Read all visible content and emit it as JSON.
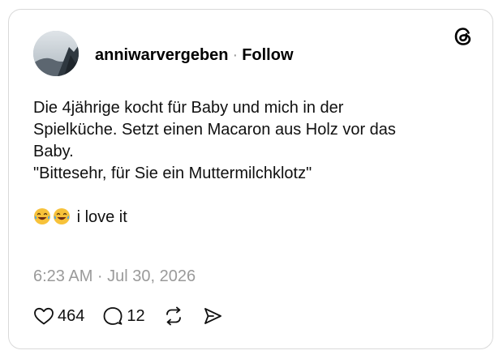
{
  "post": {
    "username": "anniwarvergeben",
    "separator": "·",
    "follow_label": "Follow",
    "text_lines": [
      "Die 4jährige kocht für Baby und mich in der",
      "Spielküche. Setzt einen Macaron aus Holz vor das",
      "Baby.",
      "\"Bittesehr, für Sie ein Muttermilchklotz\""
    ],
    "emoji_line_text": "i love it",
    "emojis": [
      "face-with-tears-of-joy",
      "face-with-tears-of-joy"
    ],
    "timestamp": "6:23 AM · Jul 30, 2026"
  },
  "actions": {
    "like_count": "464",
    "reply_count": "12"
  },
  "icons": {
    "brand": "threads-logo-icon",
    "like": "heart-icon",
    "reply": "comment-bubble-icon",
    "repost": "repost-icon",
    "share": "send-icon"
  },
  "colors": {
    "text": "#101010",
    "muted": "#9a9a9a",
    "border": "#d9d9d9",
    "emoji_face": "#f7c23a"
  }
}
